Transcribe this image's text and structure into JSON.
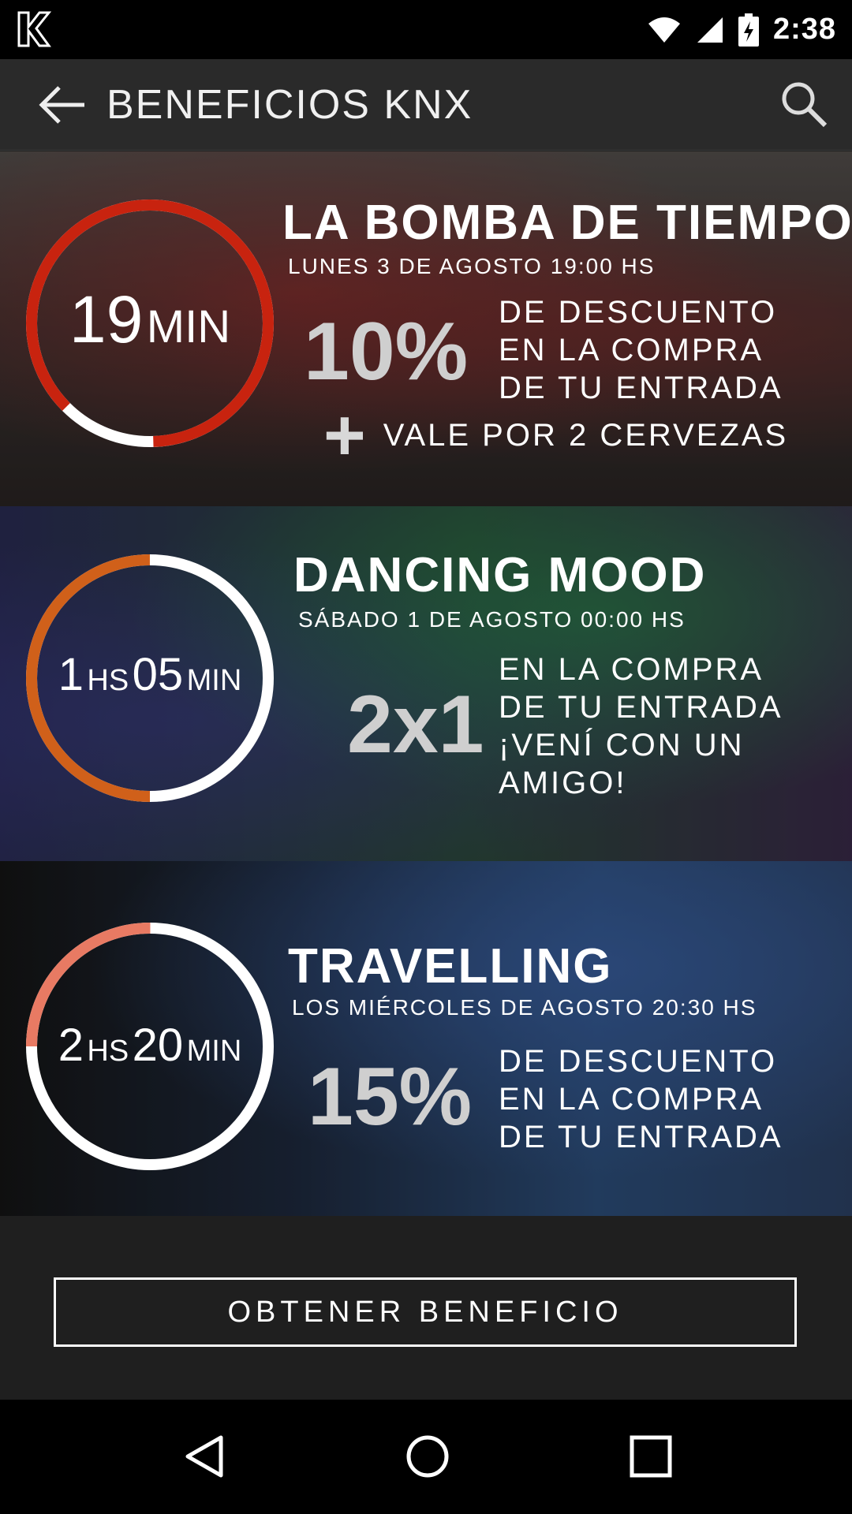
{
  "status_bar": {
    "time": "2:38"
  },
  "app_bar": {
    "title": "BENEFICIOS KNX"
  },
  "cards": [
    {
      "countdown_big": "19",
      "countdown_unit": "MIN",
      "ring_accent": "#c8230f",
      "title": "LA BOMBA DE TIEMPO",
      "date": "LUNES 3 DE AGOSTO 19:00 HS",
      "promo_value": "10%",
      "promo_text": "DE DESCUENTO\nEN LA COMPRA\nDE TU ENTRADA",
      "extra": "VALE POR 2 CERVEZAS"
    },
    {
      "countdown_h": "1",
      "countdown_h_unit": "HS",
      "countdown_m": "05",
      "countdown_m_unit": "MIN",
      "ring_accent": "#d0601a",
      "title": "DANCING MOOD",
      "date": "SÁBADO 1 DE AGOSTO 00:00 HS",
      "promo_value": "2x1",
      "promo_text": "EN LA COMPRA\nDE TU ENTRADA\n¡VENÍ CON UN\nAMIGO!"
    },
    {
      "countdown_h": "2",
      "countdown_h_unit": "HS",
      "countdown_m": "20",
      "countdown_m_unit": "MIN",
      "ring_accent": "#e87a63",
      "title": "TRAVELLING",
      "date": "LOS MIÉRCOLES DE AGOSTO 20:30 HS",
      "promo_value": "15%",
      "promo_text": "DE DESCUENTO\nEN LA COMPRA\nDE TU ENTRADA"
    }
  ],
  "cta": {
    "label": "OBTENER BENEFICIO"
  }
}
